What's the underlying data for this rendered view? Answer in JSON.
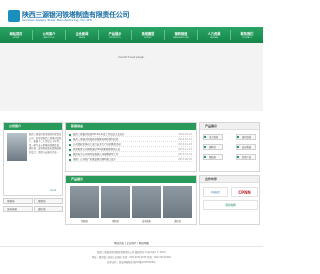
{
  "company": {
    "name_cn": "陕西三源银河铁塔制造有限责任公司",
    "name_en": "SanYuan Galaxy Tower Manufacturing .CO.,LTD."
  },
  "nav": [
    {
      "cn": "网站首页",
      "en": "HOME"
    },
    {
      "cn": "公司简介",
      "en": "ABOUT US"
    },
    {
      "cn": "企业新闻",
      "en": "NEWS"
    },
    {
      "cn": "产品展示",
      "en": "PRODUCTS"
    },
    {
      "cn": "铁塔模型",
      "en": "MODEL"
    },
    {
      "cn": "钢构制造",
      "en": "MANUFACTURE"
    },
    {
      "cn": "人力资源",
      "en": "HUMAN"
    },
    {
      "cn": "联系我们",
      "en": "CONTACT"
    }
  ],
  "hero": {
    "message": "Couldn't load plugin."
  },
  "about": {
    "title": "公司简介",
    "text": "陕西三源银河铁塔制造有限责任公司，前身是陕西三源银河铁塔厂，始建于二十世纪九十年代，是一家专业从事输电线路铁塔、通信塔、变电构架及各类钢结构的设计、制造与安装的企业...",
    "more": "more"
  },
  "news": {
    "title": "新闻动态",
    "items": [
      {
        "text": "陕西三源银河铁塔2014年年度工作总结大会召开",
        "date": "2014-02-21"
      },
      {
        "text": "陕西三源银河铁塔喜获国家电网优秀供应商",
        "date": "2014-01-15"
      },
      {
        "text": "公司组织全体员工进行安全生产培训教育活动",
        "date": "2013-12-28"
      },
      {
        "text": "热烈祝贺公司顺利通过ISO质量管理体系认证",
        "date": "2013-11-02"
      },
      {
        "text": "陕西电力公司领导莅临我公司视察指导工作",
        "date": "2013-10-19"
      },
      {
        "text": "喜报！公司新厂区建设项目顺利竣工投产",
        "date": "2013-09-05"
      }
    ]
  },
  "categories": {
    "title": "产品分类",
    "items": [
      "角钢塔",
      "钢管塔",
      "变电构架",
      "通信塔"
    ]
  },
  "products": {
    "title": "产品展示",
    "captions": [
      "角钢塔",
      "钢管塔",
      "变电构架",
      "通信塔"
    ]
  },
  "right_panel": {
    "title": "产品展示",
    "buttons": [
      "电力铁塔",
      "通讯铁塔",
      "钢管杆",
      "变电构架",
      "钢结构",
      "其他产品"
    ]
  },
  "partners": {
    "title": "合作伙伴",
    "logos": [
      "中国电力",
      "CPNN",
      "国家电网"
    ]
  },
  "footer": {
    "links": "网站首页 | 企业简介 | 网站地图",
    "line1": "陕西三源银河铁塔制造有限责任公司 版权所有 Copyright © 2014",
    "line2": "地址：陕西省三原县工业园区 电话：029-32312345 传真：029-32312346",
    "line3": "技术支持：西安网络科技 陕ICP备12345678号"
  },
  "colors": {
    "brand": "#1a6fa6",
    "nav": "#1f9a57",
    "accent": "#2a9a5a"
  }
}
